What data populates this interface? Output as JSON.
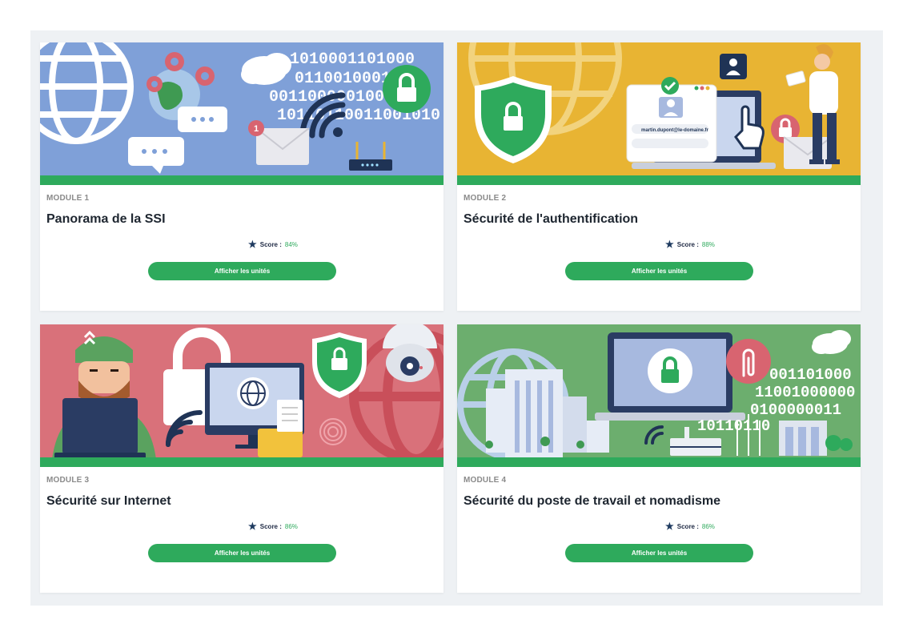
{
  "modules": [
    {
      "module_label": "MODULE 1",
      "title": "Panorama de la SSI",
      "score_label": "Score :",
      "score_value": "84%",
      "button_label": "Afficher les unités",
      "banner_color": "#7fa0d8",
      "binary_text": "1010001101000001100100011"
    },
    {
      "module_label": "MODULE 2",
      "title": "Sécurité de l'authentification",
      "score_label": "Score :",
      "score_value": "88%",
      "button_label": "Afficher les unités",
      "banner_color": "#e8b433",
      "login_text": "martin.dupont@le-domaine.fr"
    },
    {
      "module_label": "MODULE 3",
      "title": "Sécurité sur Internet",
      "score_label": "Score :",
      "score_value": "86%",
      "button_label": "Afficher les unités",
      "banner_color": "#d9717a"
    },
    {
      "module_label": "MODULE 4",
      "title": "Sécurité du poste de travail et nomadisme",
      "score_label": "Score :",
      "score_value": "86%",
      "button_label": "Afficher les unités",
      "banner_color": "#6cae6e",
      "binary_text": "001101000110010000000100000011"
    }
  ],
  "notification_count": "1",
  "accent_color": "#2eaa5c"
}
